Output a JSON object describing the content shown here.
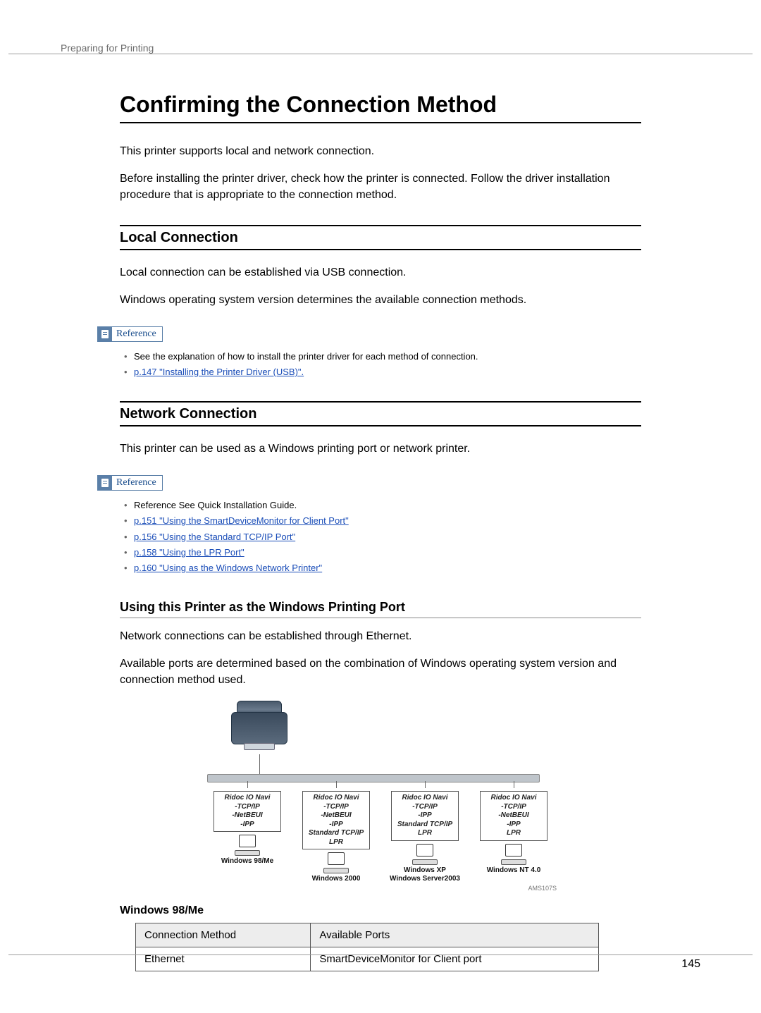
{
  "running_head": "Preparing for Printing",
  "page_number": "145",
  "title": "Confirming the Connection Method",
  "intro": {
    "p1": "This printer supports local and network connection.",
    "p2": "Before installing the printer driver, check how the printer is connected. Follow the driver installation procedure that is appropriate to the connection method."
  },
  "local": {
    "heading": "Local Connection",
    "p1": "Local connection can be established via USB connection.",
    "p2": "Windows operating system version determines the available connection methods.",
    "reference_label": "Reference",
    "items": [
      {
        "text": "See the explanation of how to install the printer driver for each method of connection.",
        "link": false
      },
      {
        "text": "p.147 \"Installing the Printer Driver (USB)\".",
        "link": true
      }
    ]
  },
  "network": {
    "heading": "Network Connection",
    "p1": "This printer can be used as a Windows printing port or network printer.",
    "reference_label": "Reference",
    "items": [
      {
        "text": "Reference See Quick Installation Guide.",
        "link": false
      },
      {
        "text": "p.151 \"Using the SmartDeviceMonitor for Client Port\"",
        "link": true
      },
      {
        "text": "p.156 \"Using the Standard TCP/IP Port\"",
        "link": true
      },
      {
        "text": "p.158 \"Using the LPR Port\"",
        "link": true
      },
      {
        "text": "p.160 \"Using as the Windows Network Printer\"",
        "link": true
      }
    ]
  },
  "printing_port": {
    "heading": "Using this Printer as the Windows Printing Port",
    "p1": "Network connections can be established through Ethernet.",
    "p2": "Available ports are determined based on the combination of Windows operating system version and connection method used."
  },
  "diagram": {
    "figure_id": "AMS107S",
    "nodes": [
      {
        "box_lines": [
          "Ridoc IO Navi",
          "-TCP/IP",
          "-NetBEUI",
          "-IPP"
        ],
        "os_lines": [
          "Windows  98/Me"
        ]
      },
      {
        "box_lines": [
          "Ridoc IO Navi",
          "-TCP/IP",
          "-NetBEUI",
          "-IPP",
          "Standard TCP/IP",
          "LPR"
        ],
        "os_lines": [
          "Windows 2000"
        ]
      },
      {
        "box_lines": [
          "Ridoc IO Navi",
          "-TCP/IP",
          "-IPP",
          "Standard TCP/IP",
          "LPR"
        ],
        "os_lines": [
          "Windows XP",
          "Windows Server2003"
        ]
      },
      {
        "box_lines": [
          "Ridoc IO Navi",
          "-TCP/IP",
          "-NetBEUI",
          "-IPP",
          "LPR"
        ],
        "os_lines": [
          "Windows NT 4.0"
        ]
      }
    ]
  },
  "table98": {
    "caption": "Windows 98/Me",
    "headers": [
      "Connection Method",
      "Available Ports"
    ],
    "rows": [
      [
        "Ethernet",
        "SmartDeviceMonitor for Client port"
      ]
    ]
  }
}
